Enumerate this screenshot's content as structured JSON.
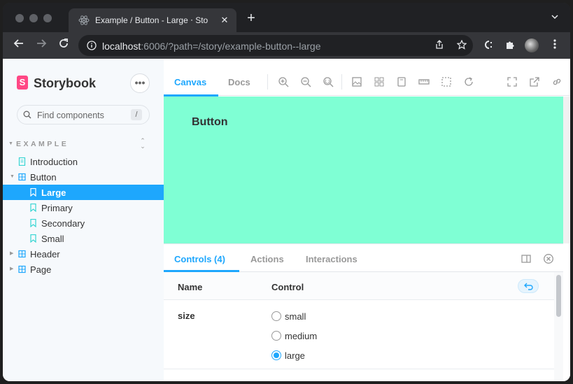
{
  "browser": {
    "tab_title": "Example / Button - Large ⋅ Sto",
    "tab_close": "✕",
    "new_tab": "+",
    "url_host": "localhost",
    "url_path": ":6006/?path=/story/example-button--large",
    "accent": "#35363a"
  },
  "sidebar": {
    "brand": "Storybook",
    "menu_label": "•••",
    "search_placeholder": "Find components",
    "search_shortcut": "/",
    "group": "EXAMPLE",
    "items": [
      {
        "label": "Introduction",
        "icon": "document-icon"
      },
      {
        "label": "Button",
        "icon": "component-icon"
      },
      {
        "label": "Large",
        "icon": "bookmark-icon",
        "selected": true
      },
      {
        "label": "Primary",
        "icon": "bookmark-icon"
      },
      {
        "label": "Secondary",
        "icon": "bookmark-icon"
      },
      {
        "label": "Small",
        "icon": "bookmark-icon"
      },
      {
        "label": "Header",
        "icon": "component-icon"
      },
      {
        "label": "Page",
        "icon": "component-icon"
      }
    ],
    "selected_color": "#1ea7fd"
  },
  "toolbar": {
    "tabs": [
      "Canvas",
      "Docs"
    ],
    "active_tab": "Canvas"
  },
  "canvas": {
    "background": "#7fffd4",
    "story_button_label": "Button"
  },
  "addons": {
    "tabs": [
      "Controls (4)",
      "Actions",
      "Interactions"
    ],
    "active_tab": "Controls (4)",
    "columns": [
      "Name",
      "Control"
    ],
    "controls": [
      {
        "name": "size",
        "options": [
          "small",
          "medium",
          "large"
        ],
        "selected": "large"
      }
    ]
  }
}
